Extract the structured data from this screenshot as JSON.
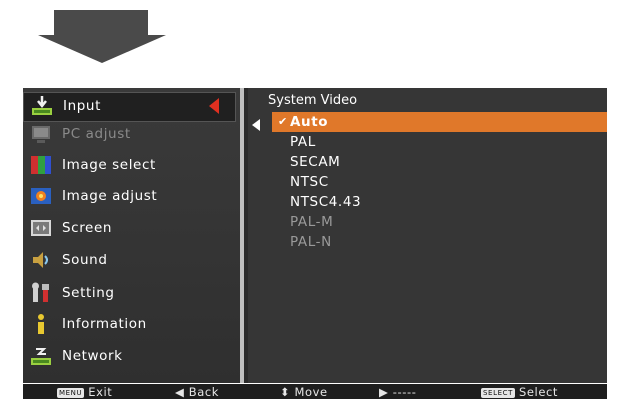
{
  "menu": {
    "items": [
      {
        "label": "Input",
        "icon": "input-icon",
        "state": "selected"
      },
      {
        "label": "PC adjust",
        "icon": "pc-adjust-icon",
        "state": "disabled"
      },
      {
        "label": "Image select",
        "icon": "image-select-icon",
        "state": "normal"
      },
      {
        "label": "Image adjust",
        "icon": "image-adjust-icon",
        "state": "normal"
      },
      {
        "label": "Screen",
        "icon": "screen-icon",
        "state": "normal"
      },
      {
        "label": "Sound",
        "icon": "sound-icon",
        "state": "normal"
      },
      {
        "label": "Setting",
        "icon": "setting-icon",
        "state": "normal"
      },
      {
        "label": "Information",
        "icon": "information-icon",
        "state": "normal"
      },
      {
        "label": "Network",
        "icon": "network-icon",
        "state": "normal"
      }
    ]
  },
  "submenu": {
    "title": "System  Video",
    "options": [
      {
        "label": "Auto",
        "state": "selected"
      },
      {
        "label": "PAL",
        "state": "normal"
      },
      {
        "label": "SECAM",
        "state": "normal"
      },
      {
        "label": "NTSC",
        "state": "normal"
      },
      {
        "label": "NTSC4.43",
        "state": "normal"
      },
      {
        "label": "PAL-M",
        "state": "disabled"
      },
      {
        "label": "PAL-N",
        "state": "disabled"
      }
    ],
    "check_mark": "✔"
  },
  "statusbar": {
    "menu_key": "MENU",
    "exit": "Exit",
    "back": "◀ Back",
    "move": "⬍ Move",
    "next": "▶ -----",
    "select_key": "SELECT",
    "select": "Select"
  },
  "colors": {
    "accent": "#e0782a",
    "selection_marker": "#e03020"
  }
}
